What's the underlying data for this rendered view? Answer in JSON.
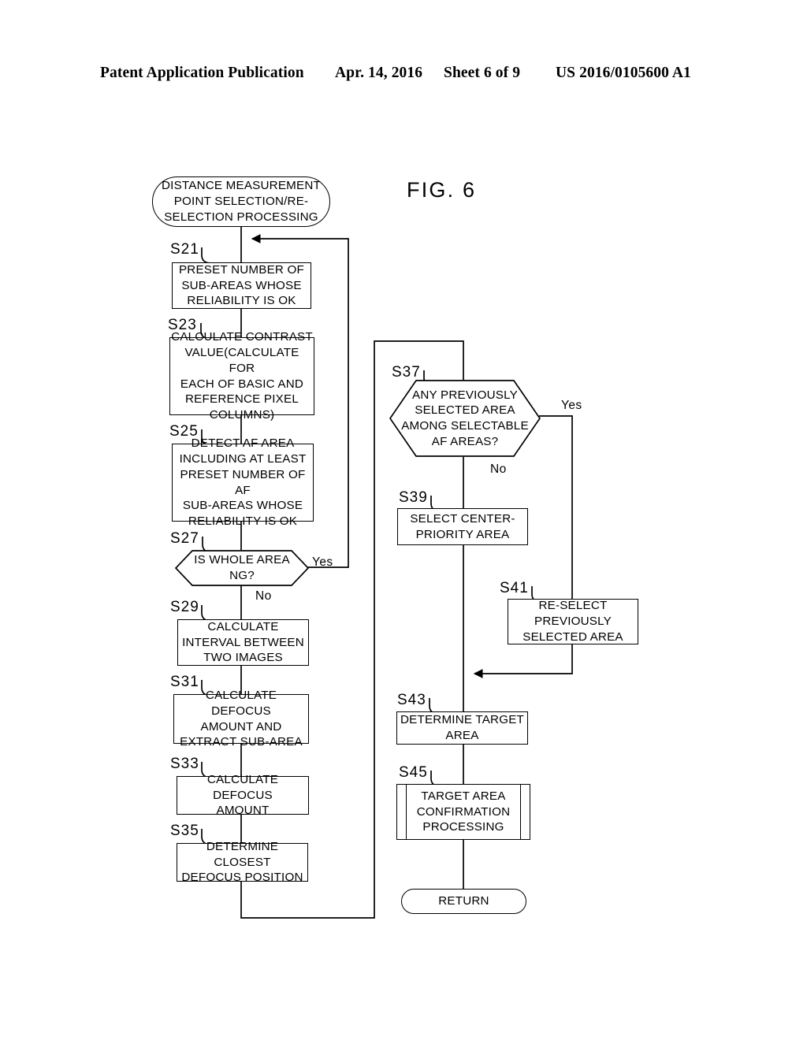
{
  "header": {
    "publication": "Patent Application Publication",
    "date": "Apr. 14, 2016",
    "sheet": "Sheet 6 of 9",
    "number": "US 2016/0105600 A1"
  },
  "figure": {
    "title": "FIG. 6",
    "line_color": "#000000"
  },
  "flowchart": {
    "nodes": [
      {
        "id": "start",
        "type": "terminal",
        "text": "DISTANCE MEASUREMENT\nPOINT SELECTION/RE-\nSELECTION PROCESSING"
      },
      {
        "id": "s21",
        "type": "process",
        "step": "S21",
        "text": "PRESET NUMBER OF\nSUB-AREAS WHOSE\nRELIABILITY IS OK"
      },
      {
        "id": "s23",
        "type": "process",
        "step": "S23",
        "text": "CALCULATE CONTRAST\nVALUE(CALCULATE FOR\nEACH OF BASIC AND\nREFERENCE PIXEL\nCOLUMNS)"
      },
      {
        "id": "s25",
        "type": "process",
        "step": "S25",
        "text": "DETECT AF AREA\nINCLUDING AT LEAST\nPRESET NUMBER OF AF\nSUB-AREAS WHOSE\nRELIABILITY IS OK"
      },
      {
        "id": "s27",
        "type": "decision",
        "step": "S27",
        "text": "IS WHOLE AREA\nNG?",
        "yes_label": "Yes",
        "no_label": "No"
      },
      {
        "id": "s29",
        "type": "process",
        "step": "S29",
        "text": "CALCULATE\nINTERVAL BETWEEN\nTWO IMAGES"
      },
      {
        "id": "s31",
        "type": "process",
        "step": "S31",
        "text": "CALCULATE DEFOCUS\nAMOUNT AND\nEXTRACT SUB-AREA"
      },
      {
        "id": "s33",
        "type": "process",
        "step": "S33",
        "text": "CALCULATE DEFOCUS\nAMOUNT"
      },
      {
        "id": "s35",
        "type": "process",
        "step": "S35",
        "text": "DETERMINE CLOSEST\nDEFOCUS POSITION"
      },
      {
        "id": "s37",
        "type": "decision",
        "step": "S37",
        "text": "ANY PREVIOUSLY\nSELECTED AREA\nAMONG SELECTABLE\nAF AREAS?",
        "yes_label": "Yes",
        "no_label": "No"
      },
      {
        "id": "s39",
        "type": "process",
        "step": "S39",
        "text": "SELECT CENTER-\nPRIORITY AREA"
      },
      {
        "id": "s41",
        "type": "process",
        "step": "S41",
        "text": "RE-SELECT\nPREVIOUSLY\nSELECTED AREA"
      },
      {
        "id": "s43",
        "type": "process",
        "step": "S43",
        "text": "DETERMINE TARGET\nAREA"
      },
      {
        "id": "s45",
        "type": "predefined-process",
        "step": "S45",
        "text": "TARGET AREA\nCONFIRMATION\nPROCESSING"
      },
      {
        "id": "return",
        "type": "terminal",
        "text": "RETURN"
      }
    ]
  }
}
